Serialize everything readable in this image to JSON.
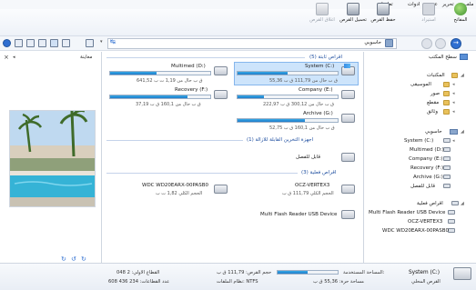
{
  "menu": [
    "ملف",
    "تحرير",
    "عرض",
    "ادوات",
    "تعليمات"
  ],
  "toolbar": {
    "open": "المفاتح",
    "restore": "استيراد",
    "save_disk": "حفظ القرص",
    "load_disk": "تحميل القرص",
    "close_disk": "اغلاق القرص"
  },
  "address": {
    "text": "حاسوبي"
  },
  "tree": {
    "desktop": "سطح المكتب",
    "libraries": "المكتبات",
    "music": "الموسيقى",
    "pictures": "صور",
    "videos": "مقطع",
    "documents": "وثائق",
    "computer": "حاسوبي",
    "drives": [
      "System (C:)",
      "Multimed (D:)",
      "Company (E:)",
      "Recovery (F:)",
      "Archive (G:)",
      "قابل للفصل"
    ],
    "virtual": "اقراص فعلية",
    "physical": [
      "Multi Flash Reader USB Device",
      "OCZ-VERTEX3",
      "WDC WD20EARX-00PASB0"
    ]
  },
  "main": {
    "section_hdd": "اقراص ثابتة (5)",
    "section_removable": "اجهزة التخرين القابلة للازالة (1)",
    "section_physical": "اقراص فعلية (3)",
    "drives": [
      {
        "name": "System (C:)",
        "sub": "55,36 ق ب حال من 111,79 ق ب",
        "fill": 0.5
      },
      {
        "name": "Multimed (D:)",
        "sub": "641,52 ق ب حال من 1,19 ت ب",
        "fill": 0.46
      },
      {
        "name": "Company (E:)",
        "sub": "222,97 ق ب حال من 300,12 ق ب",
        "fill": 0.26
      },
      {
        "name": "Recovery (F:)",
        "sub": "37,19 ق ب حال من 160,1 ق ب",
        "fill": 0.77
      },
      {
        "name": "Archive (G:)",
        "sub": "52,75 ق ب حال من 160,1 ق ب",
        "fill": 0.67
      }
    ],
    "removable": "قابل للفصل",
    "physical": [
      {
        "name": "WDC WD20EARX-00PASB0",
        "sub": "الحجم الكلي 1,82 ت ب"
      },
      {
        "name": "OCZ-VERTEX3",
        "sub": "الحجم الكلي 111,79 ق ب"
      },
      {
        "name": "Multi Flash Reader USB Device",
        "sub": ""
      }
    ]
  },
  "preview": {
    "title": "معاينة"
  },
  "status": {
    "drive": "System (C:)",
    "drive_sub": "القرص المحلي",
    "used_label": "المساحة المستخدمة:",
    "free_label": "مساحة حرة: 55,36 ق ب",
    "size_label": "حجم القرص: 111,79 ق ب",
    "fs_label": "نظام الملفات: NTFS",
    "first_sector": "القطاع الاولي: 2 048",
    "sectors": "عدد القطاعات: 234 436 608",
    "used_fill": 0.5
  },
  "colors": {
    "accent": "#1f7cc9",
    "selection": "#cde4fb"
  }
}
